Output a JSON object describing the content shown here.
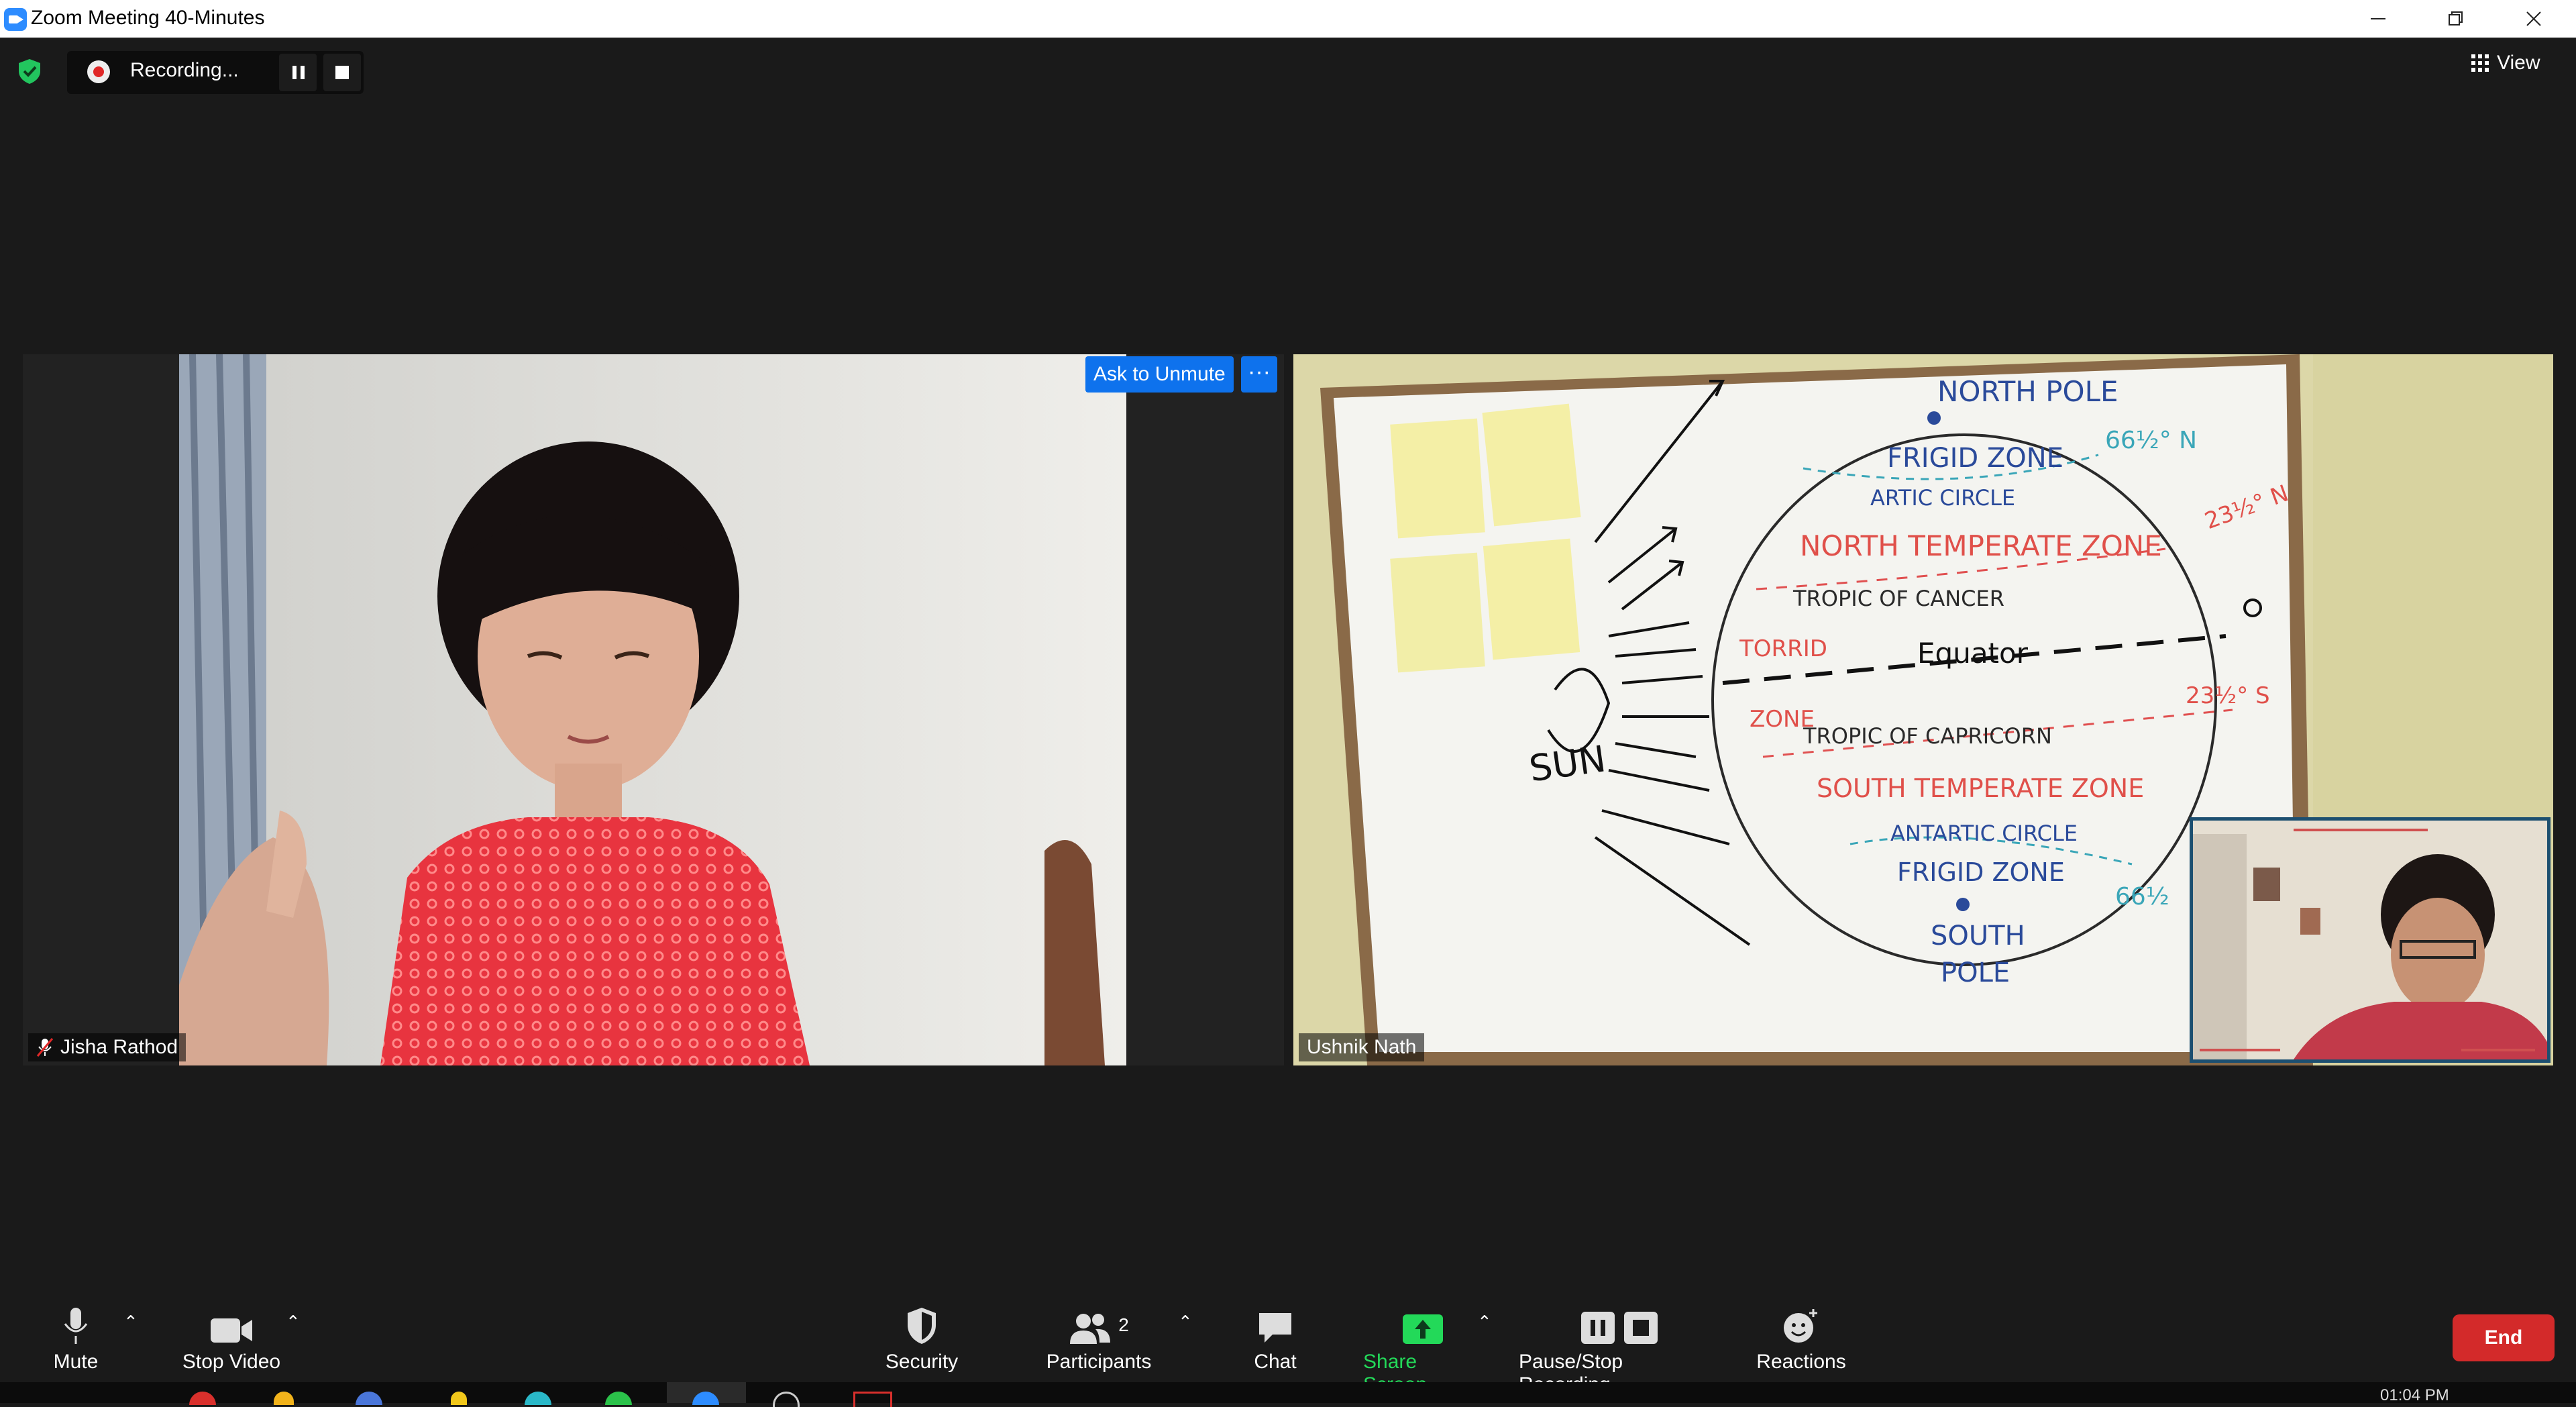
{
  "window": {
    "title": "Zoom Meeting 40-Minutes",
    "controls": [
      "minimize",
      "restore",
      "close"
    ]
  },
  "top_bar": {
    "recording_label": "Recording...",
    "view_label": "View"
  },
  "participants": [
    {
      "name": "Jisha Rathod",
      "muted": true
    },
    {
      "name": "Ushnik Nath",
      "muted": false
    }
  ],
  "tile_actions": {
    "ask_to_unmute": "Ask to Unmute",
    "more": "···"
  },
  "whiteboard": {
    "north_pole": "NORTH POLE",
    "frigid_zone_top": "FRIGID ZONE",
    "artic_circle": "ARTIC CIRCLE",
    "north_temperate": "NORTH TEMPERATE ZONE",
    "tropic_cancer": "TROPIC OF CANCER",
    "torrid": "TORRID",
    "equator": "Equator",
    "zone": "ZONE",
    "tropic_capricorn": "TROPIC OF CAPRICORN",
    "south_temperate": "SOUTH TEMPERATE ZONE",
    "antartic_circle": "ANTARTIC CIRCLE",
    "frigid_zone_bottom": "FRIGID ZONE",
    "south_pole_1": "SOUTH",
    "south_pole_2": "POLE",
    "sun": "SUN",
    "lat_n66": "66½° N",
    "lat_n23": "23½° N",
    "lat_s23": "23½° S",
    "lat_s66": "66½"
  },
  "toolbar": {
    "mute": "Mute",
    "stop_video": "Stop Video",
    "security": "Security",
    "participants": "Participants",
    "participant_count": "2",
    "chat": "Chat",
    "share_screen": "Share Screen",
    "pause_stop_recording": "Pause/Stop Recording",
    "reactions": "Reactions",
    "end": "End"
  },
  "taskbar": {
    "clock": "01:04 PM"
  },
  "colors": {
    "zoom_blue": "#0e72ed",
    "share_green": "#23d959",
    "end_red": "#d32a2a",
    "shield_green": "#22c55e"
  }
}
